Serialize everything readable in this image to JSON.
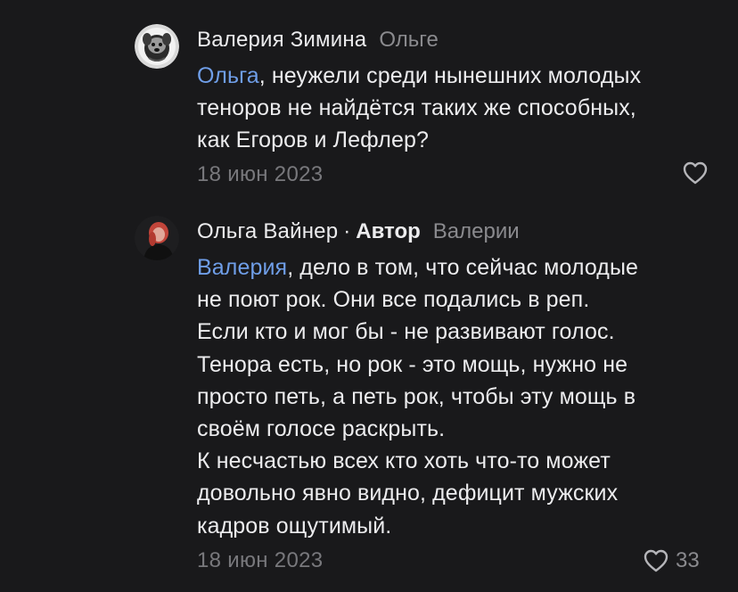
{
  "comments": [
    {
      "author": "Валерия Зимина",
      "is_author": false,
      "reply_to": "Ольге",
      "mention": "Ольга",
      "text_lines": [
        ", неужели среди нынешних молодых",
        "теноров не найдётся таких же способных,",
        "как Егоров и Лефлер?"
      ],
      "date": "18 июн 2023",
      "likes": "",
      "avatar_icon": "avatar-dog-icon"
    },
    {
      "author": "Ольга Вайнер",
      "separator": "·",
      "author_badge": "Автор",
      "is_author": true,
      "reply_to": "Валерии",
      "mention": "Валерия",
      "text_lines": [
        ", дело в том, что сейчас молодые",
        "не поют рок. Они все подались в реп.",
        "Если кто и мог бы - не развивают голос.",
        "Тенора есть, но рок - это мощь, нужно не",
        "просто петь, а петь рок, чтобы эту мощь в",
        "своём голосе раскрыть.",
        "К несчастью всех кто хоть что-то может",
        "довольно явно видно, дефицит мужских",
        "кадров ощутимый."
      ],
      "date": "18 июн 2023",
      "likes": "33",
      "avatar_icon": "avatar-woman-icon"
    }
  ],
  "colors": {
    "background": "#19191b",
    "text": "#ececee",
    "mention": "#6f9ee8",
    "muted": "#8a8a8e"
  }
}
